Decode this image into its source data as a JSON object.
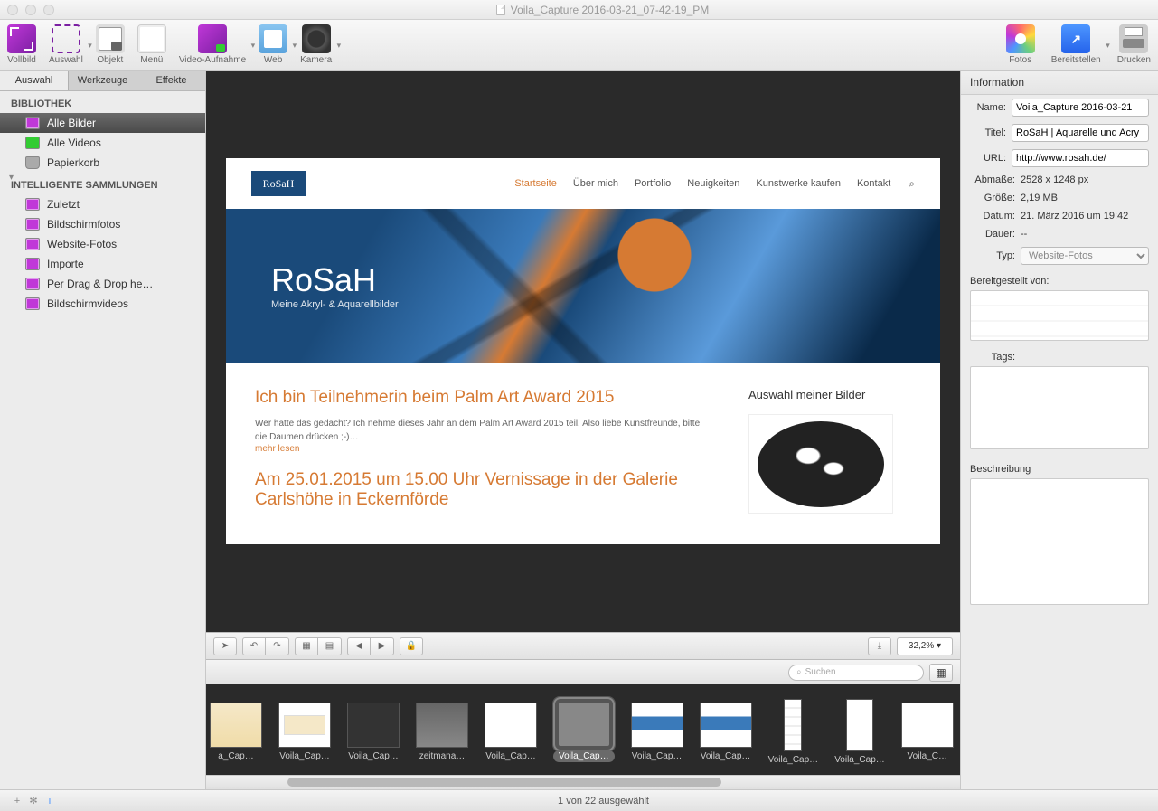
{
  "window": {
    "title": "Voila_Capture 2016-03-21_07-42-19_PM"
  },
  "toolbar": {
    "left": [
      {
        "id": "vollbild",
        "label": "Vollbild",
        "icon": "icon-vollbild",
        "dd": false
      },
      {
        "id": "auswahl",
        "label": "Auswahl",
        "icon": "icon-auswahl",
        "dd": true
      },
      {
        "id": "objekt",
        "label": "Objekt",
        "icon": "icon-objekt",
        "dd": false
      },
      {
        "id": "menu",
        "label": "Menü",
        "icon": "icon-menu",
        "dd": false
      },
      {
        "id": "video",
        "label": "Video-Aufnahme",
        "icon": "icon-video",
        "dd": true
      },
      {
        "id": "web",
        "label": "Web",
        "icon": "icon-web",
        "dd": true
      },
      {
        "id": "kamera",
        "label": "Kamera",
        "icon": "icon-kamera",
        "dd": true
      }
    ],
    "right": [
      {
        "id": "fotos",
        "label": "Fotos",
        "icon": "icon-fotos",
        "dd": false
      },
      {
        "id": "share",
        "label": "Bereitstellen",
        "icon": "icon-share",
        "dd": true
      },
      {
        "id": "print",
        "label": "Drucken",
        "icon": "icon-print",
        "dd": false
      }
    ]
  },
  "sidebar": {
    "tabs": [
      "Auswahl",
      "Werkzeuge",
      "Effekte"
    ],
    "active_tab": 0,
    "sections": [
      {
        "title": "BIBLIOTHEK",
        "items": [
          {
            "label": "Alle Bilder",
            "icon": "smart",
            "selected": true
          },
          {
            "label": "Alle Videos",
            "icon": "video"
          },
          {
            "label": "Papierkorb",
            "icon": "trash"
          }
        ]
      },
      {
        "title": "INTELLIGENTE SAMMLUNGEN",
        "disclosure": true,
        "items": [
          {
            "label": "Zuletzt",
            "icon": "smart"
          },
          {
            "label": "Bildschirmfotos",
            "icon": "smart"
          },
          {
            "label": "Website-Fotos",
            "icon": "smart"
          },
          {
            "label": "Importe",
            "icon": "smart"
          },
          {
            "label": "Per Drag & Drop he…",
            "icon": "smart"
          },
          {
            "label": "Bildschirmvideos",
            "icon": "smart"
          }
        ]
      }
    ]
  },
  "preview": {
    "site": {
      "logo": "RoSaH",
      "nav": [
        "Startseite",
        "Über mich",
        "Portfolio",
        "Neuigkeiten",
        "Kunstwerke kaufen",
        "Kontakt"
      ],
      "nav_active": 0,
      "hero_title": "RoSaH",
      "hero_sub": "Meine Akryl- & Aquarellbilder",
      "h2_1": "Ich bin Teilnehmerin beim Palm Art Award 2015",
      "p_1": "Wer hätte das gedacht? Ich nehme dieses Jahr an dem Palm Art Award 2015 teil. Also liebe Kunstfreunde, bitte die Daumen drücken ;-)…",
      "more": "mehr lesen",
      "h2_2": "Am 25.01.2015 um 15.00 Uhr Vernissage in der Galerie Carlshöhe in Eckernförde",
      "right_title": "Auswahl meiner Bilder"
    }
  },
  "editbar": {
    "zoom": "32,2%"
  },
  "searchbar": {
    "placeholder": "Suchen"
  },
  "thumbs": [
    {
      "label": "a_Cap…",
      "cls": "t1"
    },
    {
      "label": "Voila_Cap…",
      "cls": "t2"
    },
    {
      "label": "Voila_Cap…",
      "cls": "t3"
    },
    {
      "label": "zeitmana…",
      "cls": "t4"
    },
    {
      "label": "Voila_Cap…",
      "cls": "t5"
    },
    {
      "label": "Voila_Cap…",
      "cls": "site",
      "selected": true
    },
    {
      "label": "Voila_Cap…",
      "cls": "site"
    },
    {
      "label": "Voila_Cap…",
      "cls": "site"
    },
    {
      "label": "Voila_Cap…",
      "cls": "tall"
    },
    {
      "label": "Voila_Cap…",
      "cls": "tall2"
    },
    {
      "label": "Voila_C…",
      "cls": "t5"
    }
  ],
  "info": {
    "header": "Information",
    "name_lbl": "Name:",
    "name_val": "Voila_Capture 2016-03-21",
    "titel_lbl": "Titel:",
    "titel_val": "RoSaH | Aquarelle und Acry",
    "url_lbl": "URL:",
    "url_val": "http://www.rosah.de/",
    "abmasse_lbl": "Abmaße:",
    "abmasse_val": "2528 x 1248 px",
    "groesse_lbl": "Größe:",
    "groesse_val": "2,19 MB",
    "datum_lbl": "Datum:",
    "datum_val": "21. März 2016 um 19:42",
    "dauer_lbl": "Dauer:",
    "dauer_val": "--",
    "typ_lbl": "Typ:",
    "typ_val": "Website-Fotos",
    "share_title": "Bereitgestellt von:",
    "tags_lbl": "Tags:",
    "desc_title": "Beschreibung"
  },
  "status": {
    "center": "1 von 22 ausgewählt"
  }
}
